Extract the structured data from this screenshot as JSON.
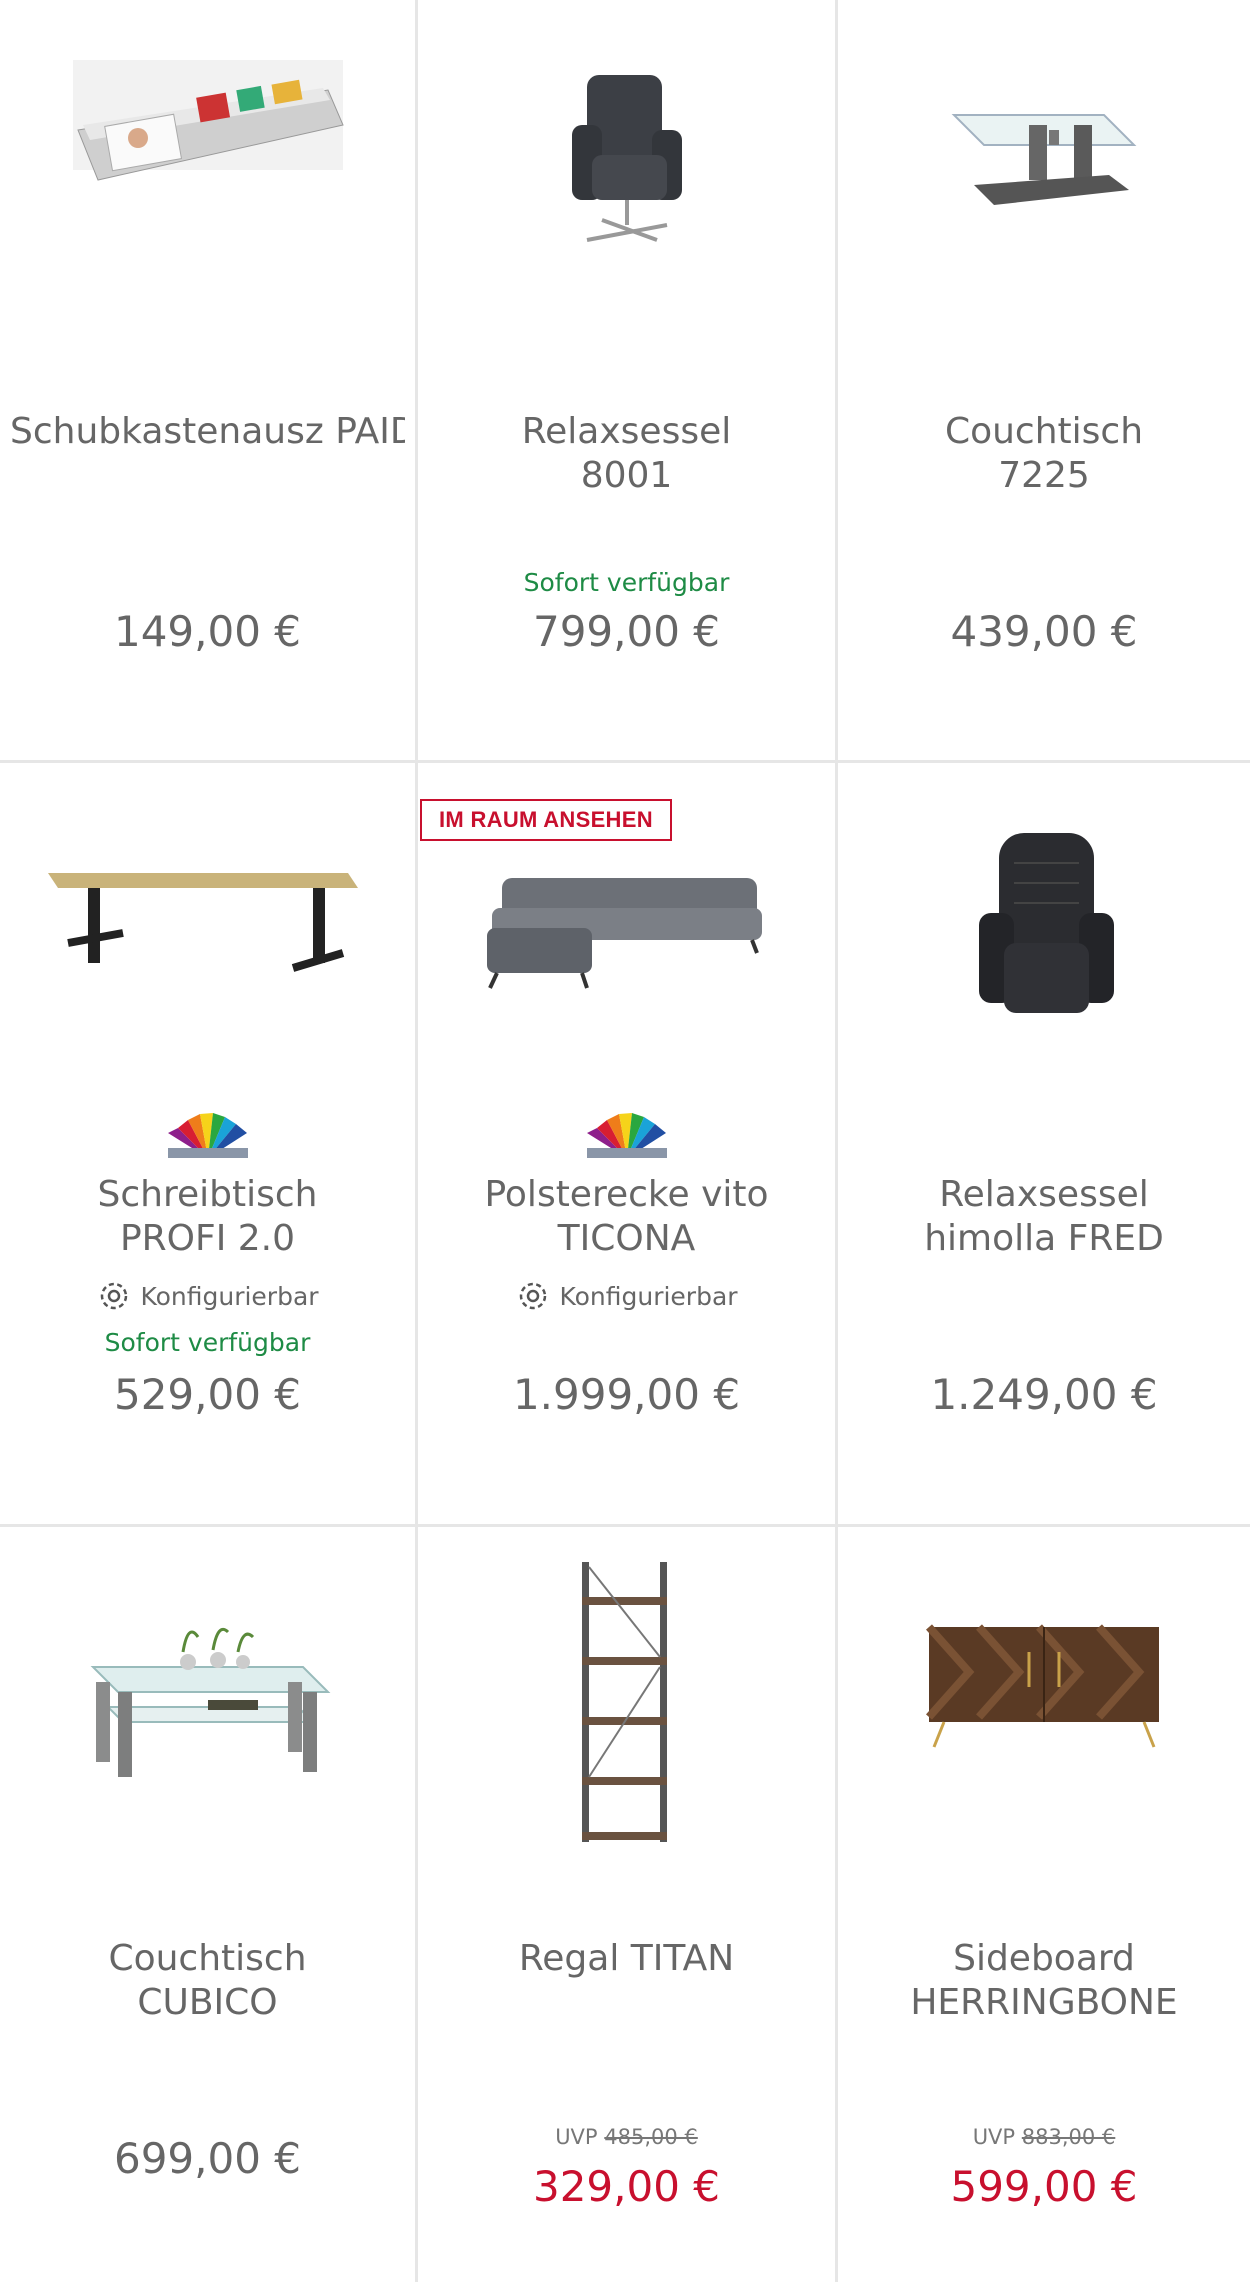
{
  "products": [
    {
      "title": "Schubkastenausz\nPAIDI JARO",
      "price": "149,00 €",
      "image": "drawer-insert-image"
    },
    {
      "title": "Relaxsessel\n8001",
      "availability": "Sofort verfügbar",
      "price": "799,00 €",
      "image": "recliner-chair-image"
    },
    {
      "title": "Couchtisch\n7225",
      "price": "439,00 €",
      "image": "glass-coffee-table-image"
    },
    {
      "title": "Schreibtisch\nPROFI 2.0",
      "config": "Konfigurierbar",
      "availability": "Sofort verfügbar",
      "price": "529,00 €",
      "image": "desk-image"
    },
    {
      "badge": "IM RAUM ANSEHEN",
      "title": "Polsterecke vito\nTICONA",
      "config": "Konfigurierbar",
      "price": "1.999,00 €",
      "image": "corner-sofa-image"
    },
    {
      "title": "Relaxsessel\nhimolla FRED",
      "price": "1.249,00 €",
      "image": "leather-recliner-image"
    },
    {
      "title": "Couchtisch\nCUBICO",
      "price": "699,00 €",
      "image": "glass-table-cubico-image"
    },
    {
      "title": "Regal TITAN",
      "uvp_label": "UVP",
      "uvp_price": "485,00 €",
      "price": "329,00 €",
      "image": "shelf-image"
    },
    {
      "title": "Sideboard\nHERRINGBONE",
      "uvp_label": "UVP",
      "uvp_price": "883,00 €",
      "price": "599,00 €",
      "image": "sideboard-image"
    }
  ],
  "colors": {
    "sale": "#c8102e",
    "available": "#1e8b45",
    "text": "#666666"
  }
}
